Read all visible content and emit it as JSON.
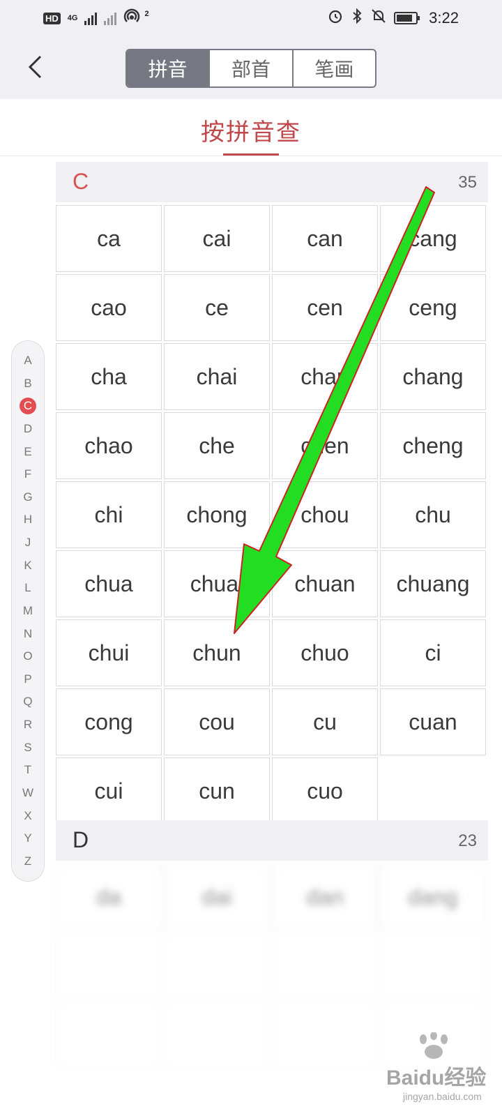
{
  "status_bar": {
    "network_badge": "HD",
    "network_type": "4G",
    "hotspot_count": "2",
    "time": "3:22"
  },
  "nav": {
    "tabs": [
      {
        "label": "拼音",
        "active": true
      },
      {
        "label": "部首",
        "active": false
      },
      {
        "label": "笔画",
        "active": false
      }
    ]
  },
  "subtitle": "按拼音查",
  "index": {
    "letters": [
      "A",
      "B",
      "C",
      "D",
      "E",
      "F",
      "G",
      "H",
      "J",
      "K",
      "L",
      "M",
      "N",
      "O",
      "P",
      "Q",
      "R",
      "S",
      "T",
      "W",
      "X",
      "Y",
      "Z"
    ],
    "active": "C"
  },
  "sections": [
    {
      "letter": "C",
      "count": "35",
      "letter_color": "#d9534f",
      "items": [
        "ca",
        "cai",
        "can",
        "cang",
        "cao",
        "ce",
        "cen",
        "ceng",
        "cha",
        "chai",
        "chan",
        "chang",
        "chao",
        "che",
        "chen",
        "cheng",
        "chi",
        "chong",
        "chou",
        "chu",
        "chua",
        "chuai",
        "chuan",
        "chuang",
        "chui",
        "chun",
        "chuo",
        "ci",
        "cong",
        "cou",
        "cu",
        "cuan",
        "cui",
        "cun",
        "cuo"
      ]
    },
    {
      "letter": "D",
      "count": "23",
      "letter_color": "#333333",
      "items": [
        "da",
        "dai",
        "dan",
        "dang"
      ]
    }
  ],
  "watermark": {
    "brand": "Baidu经验",
    "url": "jingyan.baidu.com"
  },
  "colors": {
    "accent": "#c0474a",
    "tab_active_bg": "#757783",
    "arrow_fill": "#22dd22",
    "arrow_stroke": "#cc2222"
  }
}
